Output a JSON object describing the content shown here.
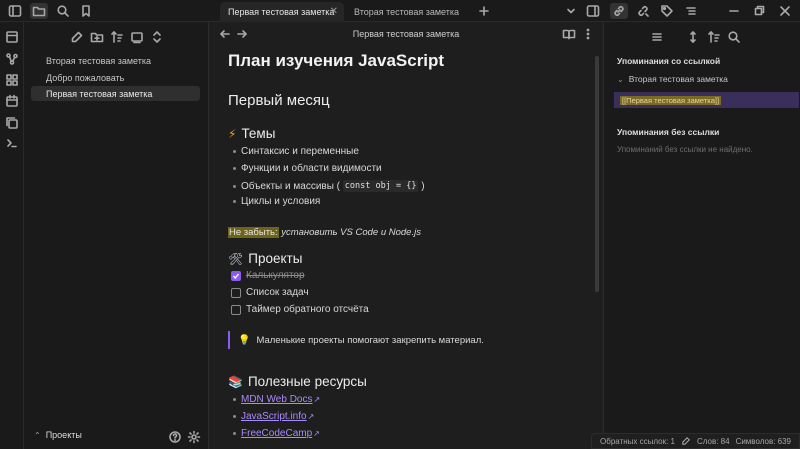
{
  "tabs": [
    {
      "label": "Первая тестовая заметка",
      "active": true
    },
    {
      "label": "Вторая тестовая заметка",
      "active": false
    }
  ],
  "left": {
    "files": [
      {
        "label": "Вторая тестовая заметка",
        "active": false
      },
      {
        "label": "Добро пожаловать",
        "active": false
      },
      {
        "label": "Первая тестовая заметка",
        "active": true
      }
    ],
    "vault_name": "Проекты"
  },
  "editor": {
    "title": "Первая тестовая заметка",
    "h1": "План изучения JavaScript",
    "h2": "Первый месяц",
    "topics": {
      "emoji": "⚡",
      "heading": "Темы",
      "items": [
        "Синтаксис и переменные",
        "Функции и области видимости",
        "Объекты и массивы (",
        "Циклы и условия"
      ],
      "code": "const obj = {}",
      "code_suffix": ")"
    },
    "reminder": {
      "highlight": "Не забыть:",
      "text": "установить VS Code и Node.js"
    },
    "projects": {
      "emoji": "🛠",
      "heading": "Проекты",
      "tasks": [
        {
          "label": "Калькулятор",
          "done": true
        },
        {
          "label": "Список задач",
          "done": false
        },
        {
          "label": "Таймер обратного отсчёта",
          "done": false
        }
      ]
    },
    "callout": {
      "emoji": "💡",
      "text": "Маленькие проекты помогают закрепить материал."
    },
    "resources": {
      "emoji": "📚",
      "heading": "Полезные ресурсы",
      "links": [
        "MDN Web Docs",
        "JavaScript.info",
        "FreeCodeCamp"
      ]
    }
  },
  "right": {
    "linked_title": "Упоминания со ссылкой",
    "linked_file": "Вторая тестовая заметка",
    "linked_match": "[[Первая тестовая заметка]]",
    "unlinked_title": "Упоминания без ссылки",
    "unlinked_empty": "Упоминаний без ссылки не найдено."
  },
  "status": {
    "backlinks": "Обратных ссылок: 1",
    "words": "Слов: 84",
    "chars": "Символов: 639"
  },
  "colors": {
    "accent": "#8a5cf5",
    "highlight": "#6e6419",
    "link": "#a88bfa"
  }
}
